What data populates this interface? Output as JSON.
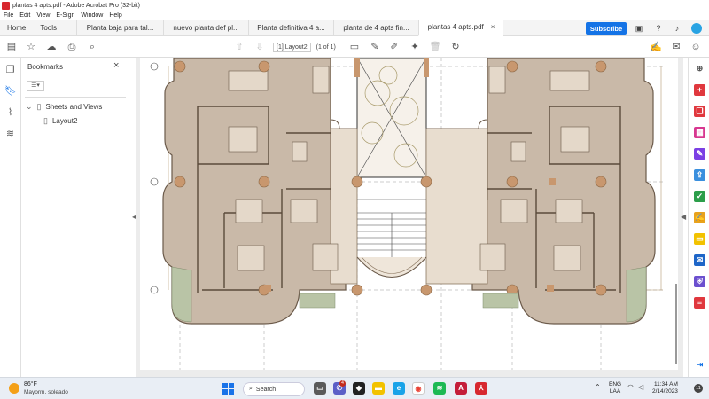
{
  "window": {
    "title": "plantas 4 apts.pdf - Adobe Acrobat Pro (32-bit)"
  },
  "menu": [
    "File",
    "Edit",
    "View",
    "E-Sign",
    "Window",
    "Help"
  ],
  "nav_tabs": [
    "Home",
    "Tools"
  ],
  "doc_tabs": [
    {
      "label": "Planta baja para tal..."
    },
    {
      "label": "nuevo planta def pl..."
    },
    {
      "label": "Planta definitiva 4 a..."
    },
    {
      "label": "planta de 4 apts fin..."
    },
    {
      "label": "plantas 4 apts.pdf",
      "close": "×"
    }
  ],
  "subscribe_label": "Subscribe",
  "toolbar": {
    "page_field": "[1] Layout2",
    "page_count": "(1 of 1)"
  },
  "bookmarks": {
    "title": "Bookmarks",
    "close": "×",
    "options": "☰▾",
    "items": [
      {
        "label": "Sheets and Views",
        "expander": "⌄"
      },
      {
        "label": "Layout2"
      }
    ]
  },
  "taskbar": {
    "weather_temp": "86°F",
    "weather_desc": "Mayorm. soleado",
    "search_label": "Search",
    "chat_badge": "4",
    "lang_top": "ENG",
    "lang_bottom": "LAA",
    "time": "11:34 AM",
    "date": "2/14/2023",
    "notifications": "11"
  },
  "colors": {
    "accent": "#1473e6",
    "floor": "#c9b9a8",
    "column": "#c8976e",
    "landscape": "#b9c4a6"
  }
}
